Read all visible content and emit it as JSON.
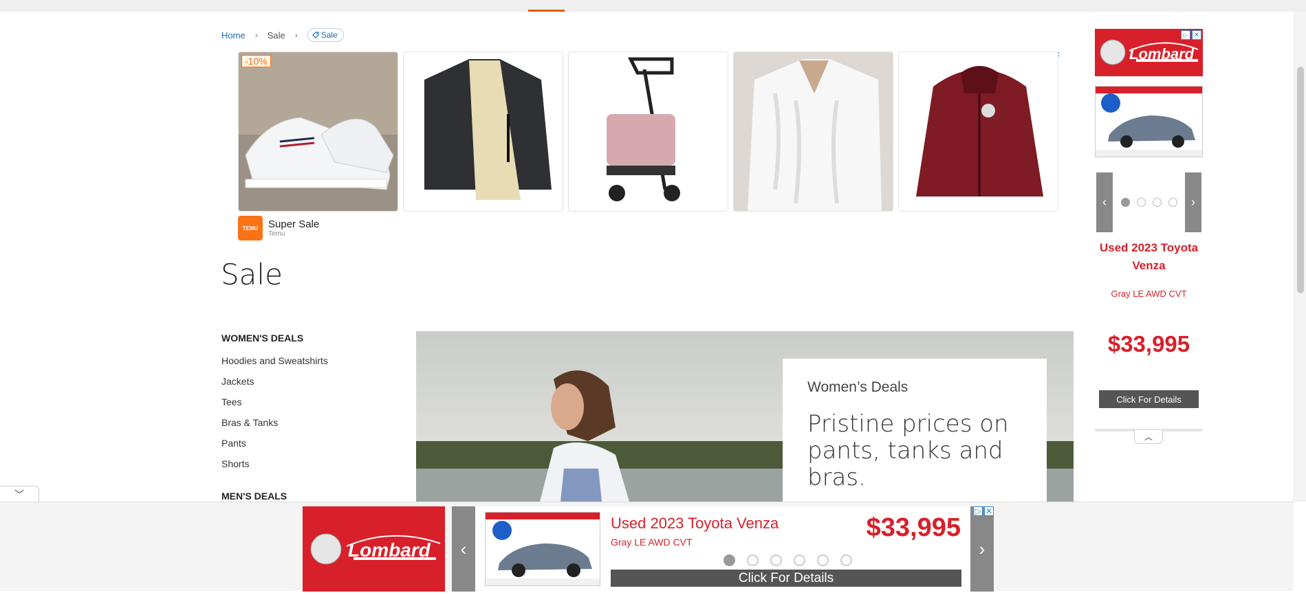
{
  "breadcrumb": {
    "home": "Home",
    "current": "Sale",
    "tag": "Sale"
  },
  "ad_strip": {
    "discount_badge": "-10%",
    "products": [
      {
        "icon": "sneakers-image"
      },
      {
        "icon": "fleece-jacket-image"
      },
      {
        "icon": "pet-stroller-image"
      },
      {
        "icon": "knit-sweater-image"
      },
      {
        "icon": "red-jacket-image"
      }
    ],
    "brand_logo_text": "TEMU",
    "brand_name": "Super Sale",
    "brand_sub": "Temu"
  },
  "page": {
    "title": "Sale"
  },
  "sidenav": {
    "womens_heading": "WOMEN'S DEALS",
    "womens_items": [
      "Hoodies and Sweatshirts",
      "Jackets",
      "Tees",
      "Bras & Tanks",
      "Pants",
      "Shorts"
    ],
    "mens_heading": "MEN'S DEALS"
  },
  "hero": {
    "kicker": "Women’s Deals",
    "headline": "Pristine prices on pants, tanks and bras."
  },
  "side_ad": {
    "logo_text": "Lombard",
    "title": "Used 2023 Toyota Venza",
    "subtitle": "Gray LE AWD CVT",
    "price": "$33,995",
    "cta": "Click For Details",
    "active_slide": 1,
    "slide_count": 4
  },
  "sticky_ad": {
    "logo_text": "Lombard",
    "title": "Used 2023 Toyota Venza",
    "subtitle": "Gray LE AWD CVT",
    "price": "$33,995",
    "cta": "Click For Details",
    "active_slide": 1,
    "slide_count": 6
  },
  "colors": {
    "accent": "#e8590c",
    "link": "#1a6bb8",
    "ad_red": "#d8202a"
  }
}
